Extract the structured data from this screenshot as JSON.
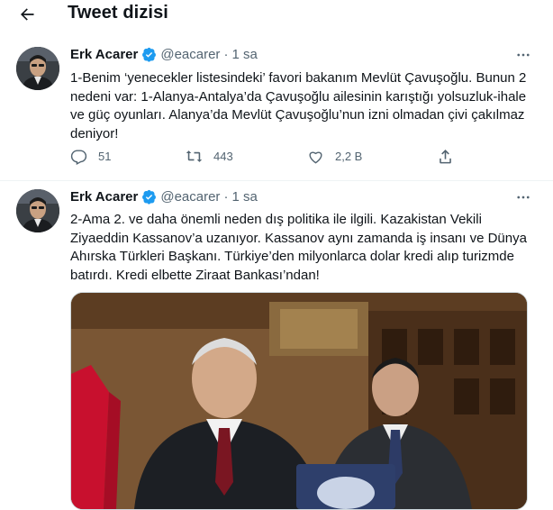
{
  "header": {
    "title": "Tweet dizisi"
  },
  "tweets": [
    {
      "name": "Erk Acarer",
      "handle": "@eacarer",
      "dot": "·",
      "time": "1 sa",
      "text": "1-Benim ‘yenecekler listesindeki’ favori bakanım Mevlüt Çavuşoğlu. Bunun 2 nedeni var: 1-Alanya-Antalya’da Çavuşoğlu ailesinin karıştığı yolsuzluk-ihale ve güç oyunları. Alanya’da Mevlüt Çavuşoğlu’nun izni olmadan çivi çakılmaz deniyor!",
      "replies": "51",
      "retweets": "443",
      "likes": "2,2 B"
    },
    {
      "name": "Erk Acarer",
      "handle": "@eacarer",
      "dot": "·",
      "time": "1 sa",
      "text": "2-Ama 2. ve daha önemli neden dış politika ile ilgili. Kazakistan Vekili Ziyaeddin Kassanov’a uzanıyor. Kassanov aynı zamanda iş insanı ve Dünya Ahırska Türkleri Başkanı. Türkiye’den milyonlarca dolar kredi alıp turizmde batırdı. Kredi elbette Ziraat Bankası’ndan!"
    }
  ],
  "icons": {
    "back": "arrow-left-icon",
    "verified": "verified-badge-icon",
    "more": "more-horizontal-icon",
    "reply": "reply-icon",
    "retweet": "retweet-icon",
    "like": "heart-icon",
    "share": "share-icon"
  },
  "colors": {
    "verified": "#1d9bf0",
    "secondary_text": "#536471",
    "primary_text": "#0f1419"
  }
}
